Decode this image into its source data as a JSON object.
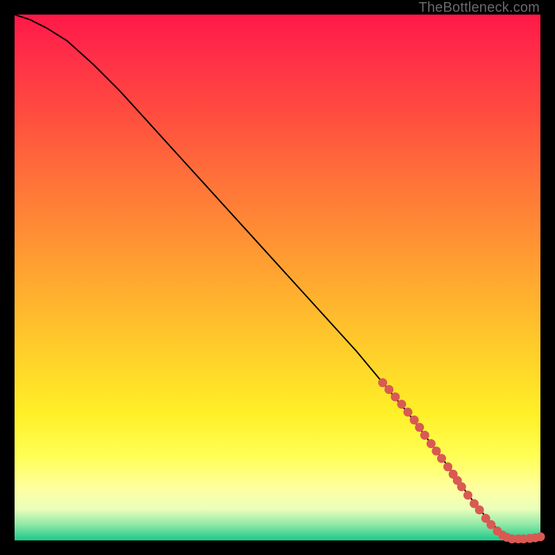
{
  "watermark": "TheBottleneck.com",
  "chart_data": {
    "type": "line",
    "title": "",
    "xlabel": "",
    "ylabel": "",
    "xlim": [
      0,
      100
    ],
    "ylim": [
      0,
      100
    ],
    "series": [
      {
        "name": "curve",
        "x": [
          0,
          3,
          6,
          10,
          15,
          20,
          25,
          30,
          35,
          40,
          45,
          50,
          55,
          60,
          65,
          70,
          75,
          78,
          81,
          84,
          86,
          88,
          90,
          92,
          94,
          96,
          98,
          100
        ],
        "y": [
          100,
          99,
          97.5,
          95,
          90.5,
          85.5,
          80,
          74.5,
          69,
          63.5,
          58,
          52.5,
          47,
          41.5,
          36,
          30,
          24,
          20,
          16,
          12,
          9,
          6.5,
          4,
          2,
          0.8,
          0.3,
          0.3,
          0.7
        ]
      }
    ],
    "markers": [
      {
        "x": 70.0,
        "y": 30.0
      },
      {
        "x": 71.2,
        "y": 28.7
      },
      {
        "x": 72.4,
        "y": 27.3
      },
      {
        "x": 73.6,
        "y": 25.9
      },
      {
        "x": 74.8,
        "y": 24.4
      },
      {
        "x": 76.0,
        "y": 22.9
      },
      {
        "x": 77.0,
        "y": 21.5
      },
      {
        "x": 78.0,
        "y": 20.0
      },
      {
        "x": 79.2,
        "y": 18.4
      },
      {
        "x": 80.2,
        "y": 17.0
      },
      {
        "x": 81.2,
        "y": 15.6
      },
      {
        "x": 82.4,
        "y": 14.0
      },
      {
        "x": 83.4,
        "y": 12.6
      },
      {
        "x": 84.2,
        "y": 11.4
      },
      {
        "x": 85.0,
        "y": 10.2
      },
      {
        "x": 86.2,
        "y": 8.6
      },
      {
        "x": 87.4,
        "y": 7.0
      },
      {
        "x": 88.4,
        "y": 5.8
      },
      {
        "x": 89.6,
        "y": 4.2
      },
      {
        "x": 90.6,
        "y": 3.0
      },
      {
        "x": 91.8,
        "y": 1.8
      },
      {
        "x": 92.8,
        "y": 1.0
      },
      {
        "x": 93.6,
        "y": 0.6
      },
      {
        "x": 94.6,
        "y": 0.3
      },
      {
        "x": 95.8,
        "y": 0.3
      },
      {
        "x": 96.8,
        "y": 0.3
      },
      {
        "x": 98.0,
        "y": 0.4
      },
      {
        "x": 99.0,
        "y": 0.5
      },
      {
        "x": 100.0,
        "y": 0.7
      }
    ],
    "marker_color": "#d85a53",
    "curve_color": "#000000"
  }
}
